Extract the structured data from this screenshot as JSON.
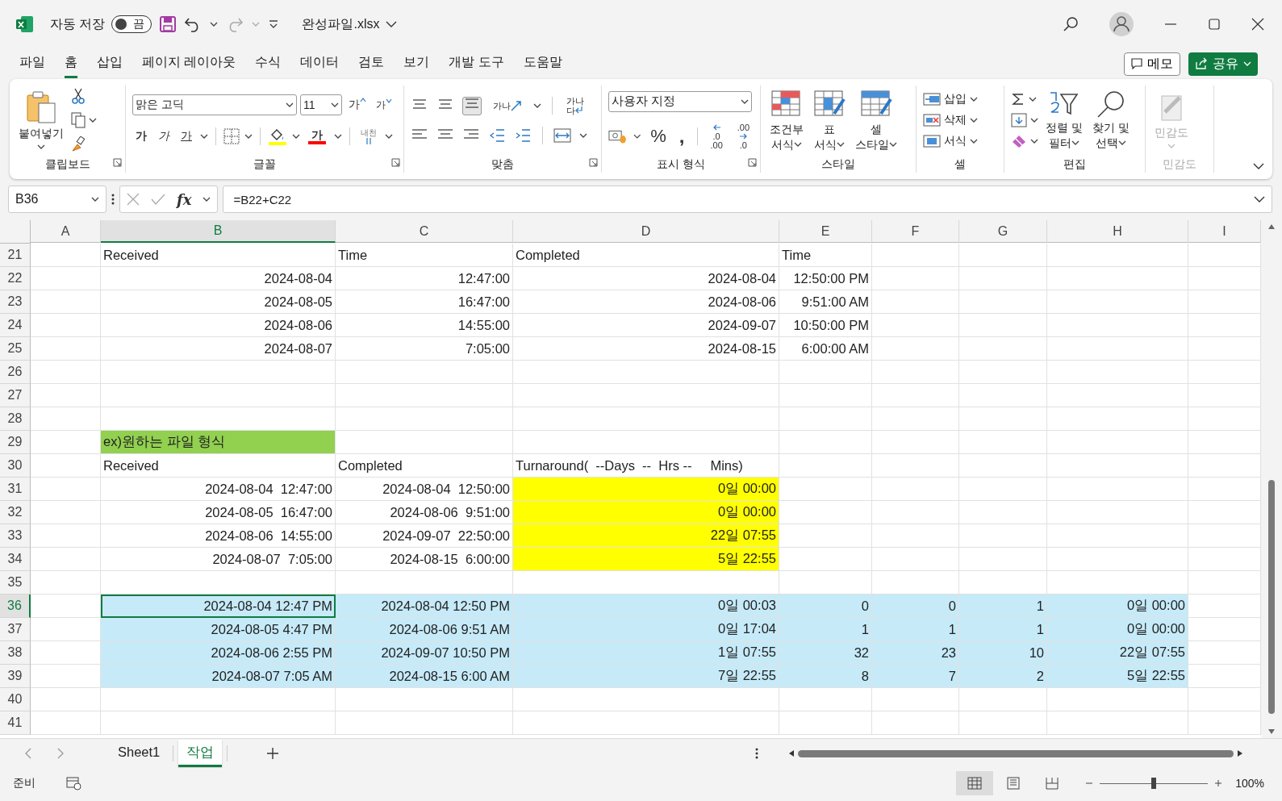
{
  "titlebar": {
    "autosave_label": "자동 저장",
    "autosave": {
      "on": false,
      "label": "끔"
    },
    "filename": "완성파일.xlsx"
  },
  "menu_tabs": [
    {
      "label": "파일",
      "selected": false
    },
    {
      "label": "홈",
      "selected": true
    },
    {
      "label": "삽입",
      "selected": false
    },
    {
      "label": "페이지 레이아웃",
      "selected": false
    },
    {
      "label": "수식",
      "selected": false
    },
    {
      "label": "데이터",
      "selected": false
    },
    {
      "label": "검토",
      "selected": false
    },
    {
      "label": "보기",
      "selected": false
    },
    {
      "label": "개발 도구",
      "selected": false
    },
    {
      "label": "도움말",
      "selected": false
    }
  ],
  "memo_button": "메모",
  "share_button": "공유",
  "ribbon": {
    "groups": [
      {
        "label": "클립보드",
        "launcher": true,
        "disabled": false,
        "buttons": [
          {
            "lines": [
              "붙여넣기"
            ]
          }
        ]
      },
      {
        "label": "글꼴",
        "launcher": true,
        "disabled": false,
        "font": "맑은 고딕",
        "size": "11",
        "glyphs": [
          "가",
          "가",
          "가",
          "가",
          "가",
          "가",
          "내천"
        ]
      },
      {
        "label": "맞춤",
        "launcher": true,
        "disabled": false,
        "glyphs": [
          "가나",
          "가나",
          "다"
        ]
      },
      {
        "label": "표시 형식",
        "launcher": true,
        "disabled": false,
        "format": "사용자 지정",
        "glyphs": [
          "%",
          ",",
          ".0",
          ".00",
          ".00",
          ".0"
        ]
      },
      {
        "label": "스타일",
        "launcher": false,
        "disabled": false,
        "buttons": [
          {
            "lines": [
              "조건부",
              "서식"
            ]
          },
          {
            "lines": [
              "표",
              "서식"
            ]
          },
          {
            "lines": [
              "셀",
              "스타일"
            ]
          }
        ]
      },
      {
        "label": "셀",
        "launcher": false,
        "disabled": false,
        "buttons": [
          {
            "lines": [
              "삽입"
            ]
          },
          {
            "lines": [
              "삭제"
            ]
          },
          {
            "lines": [
              "서식"
            ]
          }
        ]
      },
      {
        "label": "편집",
        "launcher": false,
        "disabled": false,
        "buttons": [
          {
            "lines": [
              "정렬 및",
              "필터"
            ]
          },
          {
            "lines": [
              "찾기 및",
              "선택"
            ]
          }
        ]
      },
      {
        "label": "민감도",
        "launcher": false,
        "disabled": true,
        "buttons": [
          {
            "lines": [
              "민감도"
            ]
          }
        ]
      }
    ]
  },
  "formula_bar": {
    "name_box": "B36",
    "fx": "fx",
    "formula": "=B22+C22"
  },
  "grid": {
    "columns": [
      {
        "label": "A",
        "selected": false
      },
      {
        "label": "B",
        "selected": true
      },
      {
        "label": "C",
        "selected": false
      },
      {
        "label": "D",
        "selected": false
      },
      {
        "label": "E",
        "selected": false
      },
      {
        "label": "F",
        "selected": false
      },
      {
        "label": "G",
        "selected": false
      },
      {
        "label": "H",
        "selected": false
      },
      {
        "label": "I",
        "selected": false
      }
    ],
    "rows": [
      {
        "num": "21",
        "selected": false,
        "cells": [
          null,
          {
            "text": "Received",
            "kind": "text",
            "selected": false
          },
          {
            "text": "Time",
            "kind": "text",
            "selected": false
          },
          {
            "text": "Completed",
            "kind": "text",
            "selected": false
          },
          {
            "text": "Time",
            "kind": "text",
            "selected": false
          }
        ]
      },
      {
        "num": "22",
        "selected": false,
        "cells": [
          null,
          {
            "text": "2024-08-04",
            "kind": "number",
            "selected": false
          },
          {
            "text": "12:47:00",
            "kind": "number",
            "selected": false
          },
          {
            "text": "2024-08-04",
            "kind": "number",
            "selected": false
          },
          {
            "text": "12:50:00 PM",
            "kind": "number",
            "selected": false
          }
        ]
      },
      {
        "num": "23",
        "selected": false,
        "cells": [
          null,
          {
            "text": "2024-08-05",
            "kind": "number",
            "selected": false
          },
          {
            "text": "16:47:00",
            "kind": "number",
            "selected": false
          },
          {
            "text": "2024-08-06",
            "kind": "number",
            "selected": false
          },
          {
            "text": "9:51:00 AM",
            "kind": "number",
            "selected": false
          }
        ]
      },
      {
        "num": "24",
        "selected": false,
        "cells": [
          null,
          {
            "text": "2024-08-06",
            "kind": "number",
            "selected": false
          },
          {
            "text": "14:55:00",
            "kind": "number",
            "selected": false
          },
          {
            "text": "2024-09-07",
            "kind": "number",
            "selected": false
          },
          {
            "text": "10:50:00 PM",
            "kind": "number",
            "selected": false
          }
        ]
      },
      {
        "num": "25",
        "selected": false,
        "cells": [
          null,
          {
            "text": "2024-08-07",
            "kind": "number",
            "selected": false
          },
          {
            "text": "7:05:00",
            "kind": "number",
            "selected": false
          },
          {
            "text": "2024-08-15",
            "kind": "number",
            "selected": false
          },
          {
            "text": "6:00:00 AM",
            "kind": "number",
            "selected": false
          }
        ]
      },
      {
        "num": "26",
        "selected": false,
        "cells": []
      },
      {
        "num": "27",
        "selected": false,
        "cells": []
      },
      {
        "num": "28",
        "selected": false,
        "cells": []
      },
      {
        "num": "29",
        "selected": false,
        "cells": [
          null,
          {
            "text": "ex)원하는 파일 형식",
            "kind": "text",
            "selected": false,
            "color": "#92d050"
          }
        ]
      },
      {
        "num": "30",
        "selected": false,
        "cells": [
          null,
          {
            "text": "Received",
            "kind": "text",
            "selected": false
          },
          {
            "text": "Completed",
            "kind": "text",
            "selected": false
          },
          {
            "text": "Turnaround(  --Days  --  Hrs --     Mins)",
            "kind": "text",
            "selected": false
          }
        ]
      },
      {
        "num": "31",
        "selected": false,
        "cells": [
          null,
          {
            "text": "2024-08-04  12:47:00",
            "kind": "number",
            "selected": false
          },
          {
            "text": "2024-08-04  12:50:00",
            "kind": "number",
            "selected": false
          },
          {
            "text": "0일 00:00",
            "kind": "number",
            "selected": false,
            "color": "#ffff00"
          }
        ]
      },
      {
        "num": "32",
        "selected": false,
        "cells": [
          null,
          {
            "text": "2024-08-05  16:47:00",
            "kind": "number",
            "selected": false
          },
          {
            "text": "2024-08-06  9:51:00",
            "kind": "number",
            "selected": false
          },
          {
            "text": "0일 00:00",
            "kind": "number",
            "selected": false,
            "color": "#ffff00"
          }
        ]
      },
      {
        "num": "33",
        "selected": false,
        "cells": [
          null,
          {
            "text": "2024-08-06  14:55:00",
            "kind": "number",
            "selected": false
          },
          {
            "text": "2024-09-07  22:50:00",
            "kind": "number",
            "selected": false
          },
          {
            "text": "22일 07:55",
            "kind": "number",
            "selected": false,
            "color": "#ffff00"
          }
        ]
      },
      {
        "num": "34",
        "selected": false,
        "cells": [
          null,
          {
            "text": "2024-08-07  7:05:00",
            "kind": "number",
            "selected": false
          },
          {
            "text": "2024-08-15  6:00:00",
            "kind": "number",
            "selected": false
          },
          {
            "text": "5일 22:55",
            "kind": "number",
            "selected": false,
            "color": "#ffff00"
          }
        ]
      },
      {
        "num": "35",
        "selected": false,
        "cells": []
      },
      {
        "num": "36",
        "selected": true,
        "cells": [
          null,
          {
            "text": "2024-08-04 12:47 PM",
            "kind": "number",
            "selected": true,
            "color": "#c6eaf8"
          },
          {
            "text": "2024-08-04 12:50 PM",
            "kind": "number",
            "selected": false,
            "color": "#c6eaf8"
          },
          {
            "text": "0일 00:03",
            "kind": "number",
            "selected": false,
            "color": "#c6eaf8"
          },
          {
            "text": "0",
            "kind": "number",
            "selected": false,
            "color": "#c6eaf8"
          },
          {
            "text": "0",
            "kind": "number",
            "selected": false,
            "color": "#c6eaf8"
          },
          {
            "text": "1",
            "kind": "number",
            "selected": false,
            "color": "#c6eaf8"
          },
          {
            "text": "0일 00:00",
            "kind": "number",
            "selected": false,
            "color": "#c6eaf8"
          }
        ]
      },
      {
        "num": "37",
        "selected": false,
        "cells": [
          null,
          {
            "text": "2024-08-05 4:47 PM",
            "kind": "number",
            "selected": false,
            "color": "#c6eaf8"
          },
          {
            "text": "2024-08-06 9:51 AM",
            "kind": "number",
            "selected": false,
            "color": "#c6eaf8"
          },
          {
            "text": "0일 17:04",
            "kind": "number",
            "selected": false,
            "color": "#c6eaf8"
          },
          {
            "text": "1",
            "kind": "number",
            "selected": false,
            "color": "#c6eaf8"
          },
          {
            "text": "1",
            "kind": "number",
            "selected": false,
            "color": "#c6eaf8"
          },
          {
            "text": "1",
            "kind": "number",
            "selected": false,
            "color": "#c6eaf8"
          },
          {
            "text": "0일 00:00",
            "kind": "number",
            "selected": false,
            "color": "#c6eaf8"
          }
        ]
      },
      {
        "num": "38",
        "selected": false,
        "cells": [
          null,
          {
            "text": "2024-08-06 2:55 PM",
            "kind": "number",
            "selected": false,
            "color": "#c6eaf8"
          },
          {
            "text": "2024-09-07 10:50 PM",
            "kind": "number",
            "selected": false,
            "color": "#c6eaf8"
          },
          {
            "text": "1일 07:55",
            "kind": "number",
            "selected": false,
            "color": "#c6eaf8"
          },
          {
            "text": "32",
            "kind": "number",
            "selected": false,
            "color": "#c6eaf8"
          },
          {
            "text": "23",
            "kind": "number",
            "selected": false,
            "color": "#c6eaf8"
          },
          {
            "text": "10",
            "kind": "number",
            "selected": false,
            "color": "#c6eaf8"
          },
          {
            "text": "22일 07:55",
            "kind": "number",
            "selected": false,
            "color": "#c6eaf8"
          }
        ]
      },
      {
        "num": "39",
        "selected": false,
        "cells": [
          null,
          {
            "text": "2024-08-07 7:05 AM",
            "kind": "number",
            "selected": false,
            "color": "#c6eaf8"
          },
          {
            "text": "2024-08-15 6:00 AM",
            "kind": "number",
            "selected": false,
            "color": "#c6eaf8"
          },
          {
            "text": "7일 22:55",
            "kind": "number",
            "selected": false,
            "color": "#c6eaf8"
          },
          {
            "text": "8",
            "kind": "number",
            "selected": false,
            "color": "#c6eaf8"
          },
          {
            "text": "7",
            "kind": "number",
            "selected": false,
            "color": "#c6eaf8"
          },
          {
            "text": "2",
            "kind": "number",
            "selected": false,
            "color": "#c6eaf8"
          },
          {
            "text": "5일 22:55",
            "kind": "number",
            "selected": false,
            "color": "#c6eaf8"
          }
        ]
      },
      {
        "num": "40",
        "selected": false,
        "cells": []
      },
      {
        "num": "41",
        "selected": false,
        "cells": []
      }
    ]
  },
  "sheet_tabs": [
    {
      "label": "Sheet1",
      "selected": false
    },
    {
      "label": "작업",
      "selected": true
    }
  ],
  "status_bar": {
    "status": "준비",
    "views": [
      {
        "selected": true
      },
      {
        "selected": false
      },
      {
        "selected": false
      }
    ],
    "zoom": {
      "level": 0.5,
      "reading": "100%"
    }
  }
}
